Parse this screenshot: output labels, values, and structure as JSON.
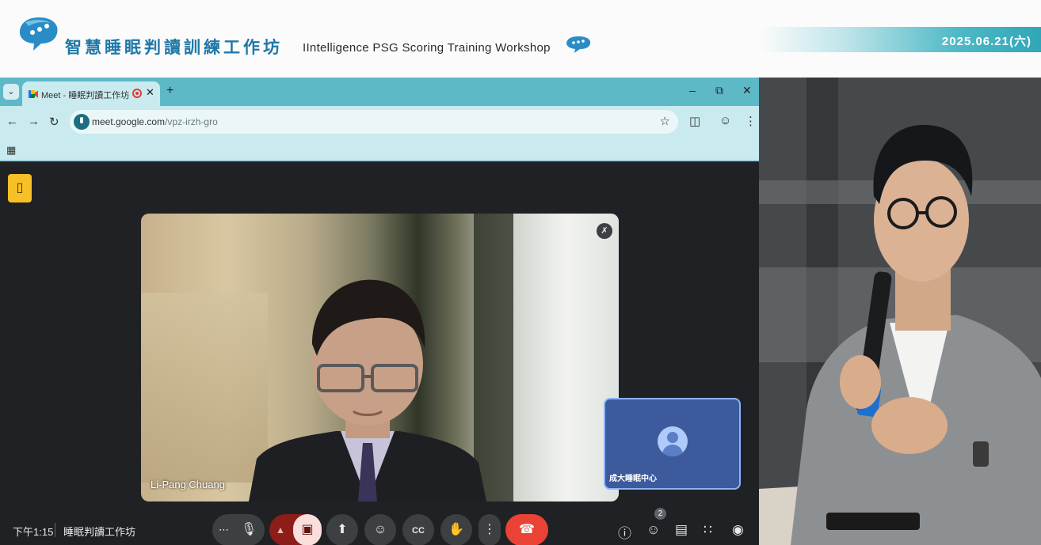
{
  "banner": {
    "title": "智慧睡眠判讀訓練工作坊",
    "subtitle": "IIntelligence PSG Scoring Training Workshop",
    "date": "2025.06.21(六)"
  },
  "browser": {
    "tab_title": "Meet - 睡眠判讀工作坊",
    "url_host": "meet.google.com",
    "url_path": "/vpz-irzh-gro"
  },
  "meet": {
    "main_participant": "Li-Pang Chuang",
    "self_participant": "成大睡眠中心",
    "time": "下午1:15",
    "meeting_name": "睡眠判讀工作坊",
    "people_count": "2"
  },
  "colors": {
    "banner_title": "#1f78a8",
    "tabbar": "#5eb9c7",
    "toolbar": "#c9eaef",
    "meet_bg": "#202124",
    "end_call": "#ea4335"
  },
  "icons": {
    "tab_menu": "chevron-down-icon",
    "back": "arrow-left-icon",
    "forward": "arrow-right-icon",
    "reload": "reload-icon",
    "star": "star-icon",
    "extensions": "puzzle-icon",
    "profile": "profile-icon",
    "menu": "kebab-icon",
    "apps": "apps-grid-icon",
    "mic": "mic-icon",
    "camera_off": "video-off-icon",
    "present": "present-icon",
    "emoji": "emoji-icon",
    "captions": "captions-icon",
    "hand": "raise-hand-icon",
    "end_call": "phone-hangup-icon",
    "info": "info-icon",
    "people": "people-icon",
    "chat": "chat-icon",
    "activities": "activities-icon",
    "host_controls": "lock-icon"
  }
}
